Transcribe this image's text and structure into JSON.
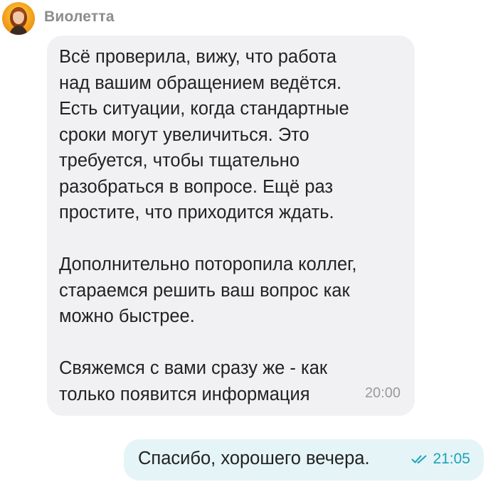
{
  "incoming_message": {
    "sender_name": "Виолетта",
    "paragraphs": [
      "Всё проверила, вижу, что работа\nнад вашим обращением ведётся.\nЕсть ситуации, когда стандартные\nсроки могут увеличиться. Это\nтребуется, чтобы тщательно\nразобраться в вопросе. Ещё раз\nпростите, что приходится ждать.",
      "Дополнительно поторопила коллег,\nстараемся решить ваш вопрос как\nможно быстрее.",
      "Свяжемся с вами сразу же - как\nтолько появится информация"
    ],
    "time": "20:00"
  },
  "outgoing_message": {
    "text": "Спасибо, хорошего вечера.",
    "time": "21:05",
    "status_icon": "double-check-icon"
  },
  "colors": {
    "incoming_bubble": "#f1f1f3",
    "outgoing_bubble": "#e5f4f7",
    "accent": "#1ba2b8"
  }
}
